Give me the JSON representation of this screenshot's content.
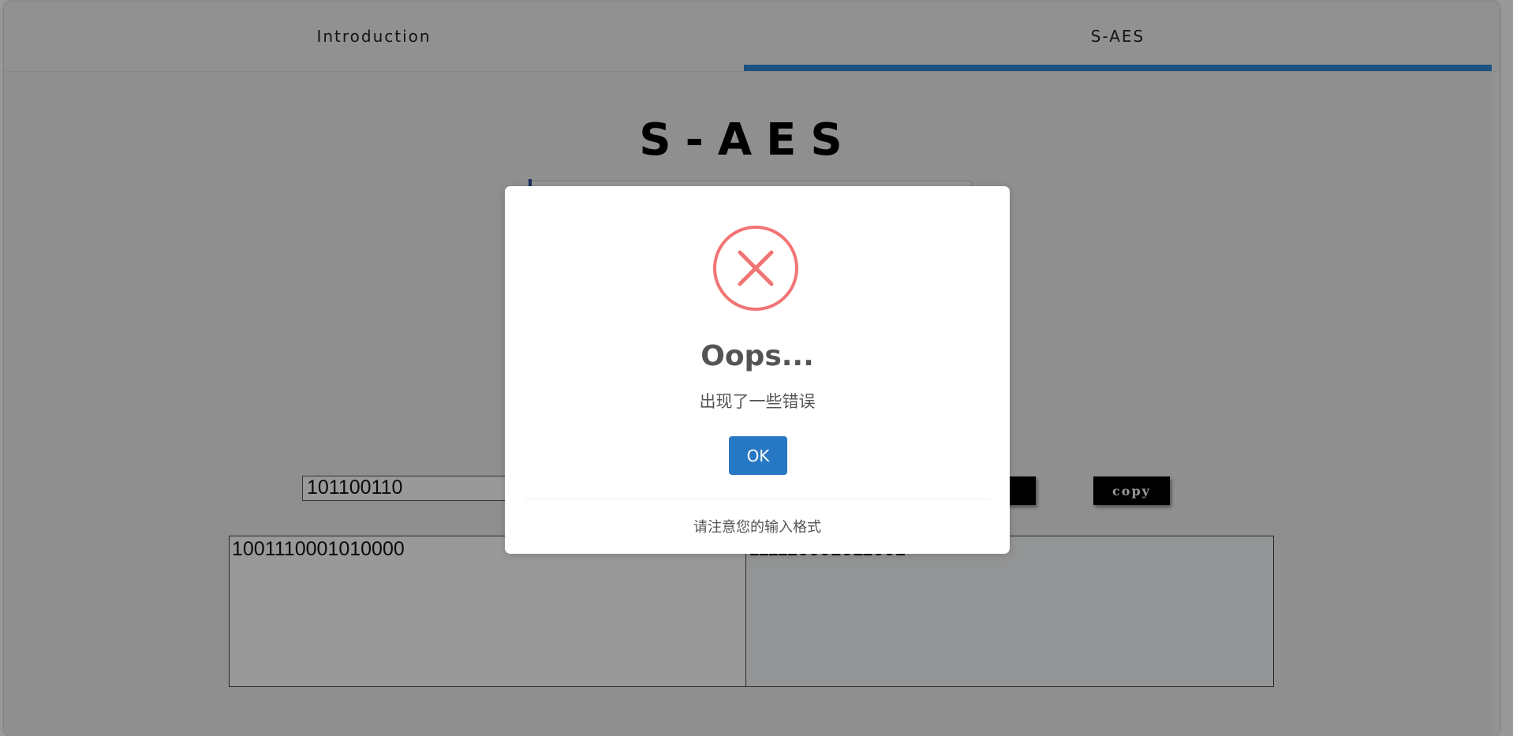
{
  "tabs": [
    {
      "label": "Introduction",
      "active": false
    },
    {
      "label": "S-AES",
      "active": true
    }
  ],
  "accent_color": "#2f88d8",
  "main": {
    "title": "S-AES",
    "input_value": "101100110",
    "decode_button_label": "e",
    "copy_button_label": "copy",
    "input_text": "1001110001010000",
    "output_text": "111110001011001"
  },
  "dialog": {
    "icon": "error-x-icon",
    "icon_color": "#f27474",
    "title": "Oops...",
    "message": "出现了一些错误",
    "ok_label": "OK",
    "ok_color": "#2778c4",
    "footer": "请注意您的输入格式"
  }
}
